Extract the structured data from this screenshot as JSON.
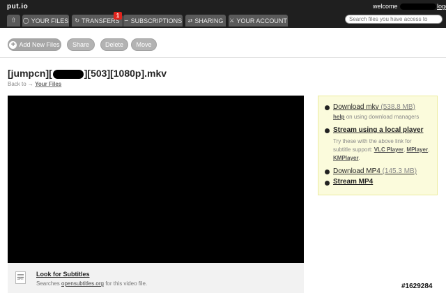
{
  "header": {
    "logo": "put.io",
    "welcome_prefix": "welcome",
    "logout": "logout",
    "search_placeholder": "Search files you have access to"
  },
  "nav": {
    "home_icon": "home-icon",
    "tabs": [
      {
        "label": "YOUR FILES",
        "icon": "files-icon"
      },
      {
        "label": "TRANSFERS",
        "icon": "transfers-icon"
      },
      {
        "label": "SUBSCRIPTIONS",
        "icon": "rss-icon"
      },
      {
        "label": "SHARING",
        "icon": "share-icon"
      },
      {
        "label": "YOUR ACCOUNT",
        "icon": "account-icon"
      }
    ],
    "transfers_badge": "1"
  },
  "toolbar": {
    "add": "Add New Files",
    "share": "Share",
    "delete": "Delete",
    "move": "Move"
  },
  "file": {
    "title_start": "[jumpcn][",
    "title_end": "][503][1080p].mkv",
    "back_prefix": "Back to →",
    "back_link": "Your Files"
  },
  "subtitles": {
    "icon_label": "SRT",
    "title": "Look for Subtitles",
    "desc_prefix": "Searches",
    "desc_link": "opensubtitles.org",
    "desc_suffix": "for this video file."
  },
  "panel": {
    "download_mkv": "Download mkv",
    "download_mkv_size": "(538.8 MB)",
    "help_link": "help",
    "help_text": "on using download managers",
    "stream_local": "Stream using a local player",
    "note_line1": "Try these with the above link for",
    "note_line2_prefix": "subtitle support:",
    "vlc": "VLC Player",
    "mplayer": "MPlayer",
    "kmplayer": "KMPlayer",
    "download_mp4": "Download MP4",
    "download_mp4_size": "(145.3 MB)",
    "stream_mp4": "Stream MP4"
  },
  "watermark": "#1629284"
}
